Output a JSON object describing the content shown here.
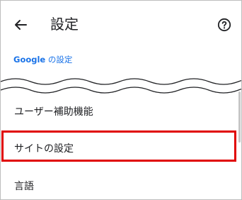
{
  "header": {
    "title": "設定",
    "back_icon": "arrow-left-icon",
    "help_icon": "help-circle-icon"
  },
  "google_settings": {
    "brand": "Google",
    "suffix": " の設定"
  },
  "list": {
    "items": [
      {
        "label": "ユーザー補助機能"
      },
      {
        "label": "サイトの設定"
      },
      {
        "label": "言語"
      }
    ]
  },
  "colors": {
    "link": "#1a73e8",
    "highlight_border": "#e00000",
    "text": "#202124"
  }
}
